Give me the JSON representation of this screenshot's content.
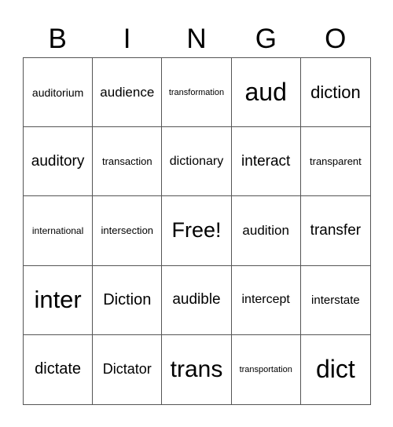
{
  "header": [
    "B",
    "I",
    "N",
    "G",
    "O"
  ],
  "cells": [
    {
      "text": "auditorium",
      "size": 14
    },
    {
      "text": "audience",
      "size": 17
    },
    {
      "text": "transformation",
      "size": 11
    },
    {
      "text": "aud",
      "size": 32
    },
    {
      "text": "diction",
      "size": 22
    },
    {
      "text": "auditory",
      "size": 19
    },
    {
      "text": "transaction",
      "size": 13
    },
    {
      "text": "dictionary",
      "size": 16
    },
    {
      "text": "interact",
      "size": 19
    },
    {
      "text": "transparent",
      "size": 13
    },
    {
      "text": "international",
      "size": 12
    },
    {
      "text": "intersection",
      "size": 13
    },
    {
      "text": "Free!",
      "size": 27
    },
    {
      "text": "audition",
      "size": 17
    },
    {
      "text": "transfer",
      "size": 19
    },
    {
      "text": "inter",
      "size": 31
    },
    {
      "text": "Diction",
      "size": 20
    },
    {
      "text": "audible",
      "size": 19
    },
    {
      "text": "intercept",
      "size": 16
    },
    {
      "text": "interstate",
      "size": 15
    },
    {
      "text": "dictate",
      "size": 20
    },
    {
      "text": "Dictator",
      "size": 18
    },
    {
      "text": "trans",
      "size": 30
    },
    {
      "text": "transportation",
      "size": 11
    },
    {
      "text": "dict",
      "size": 32
    }
  ]
}
